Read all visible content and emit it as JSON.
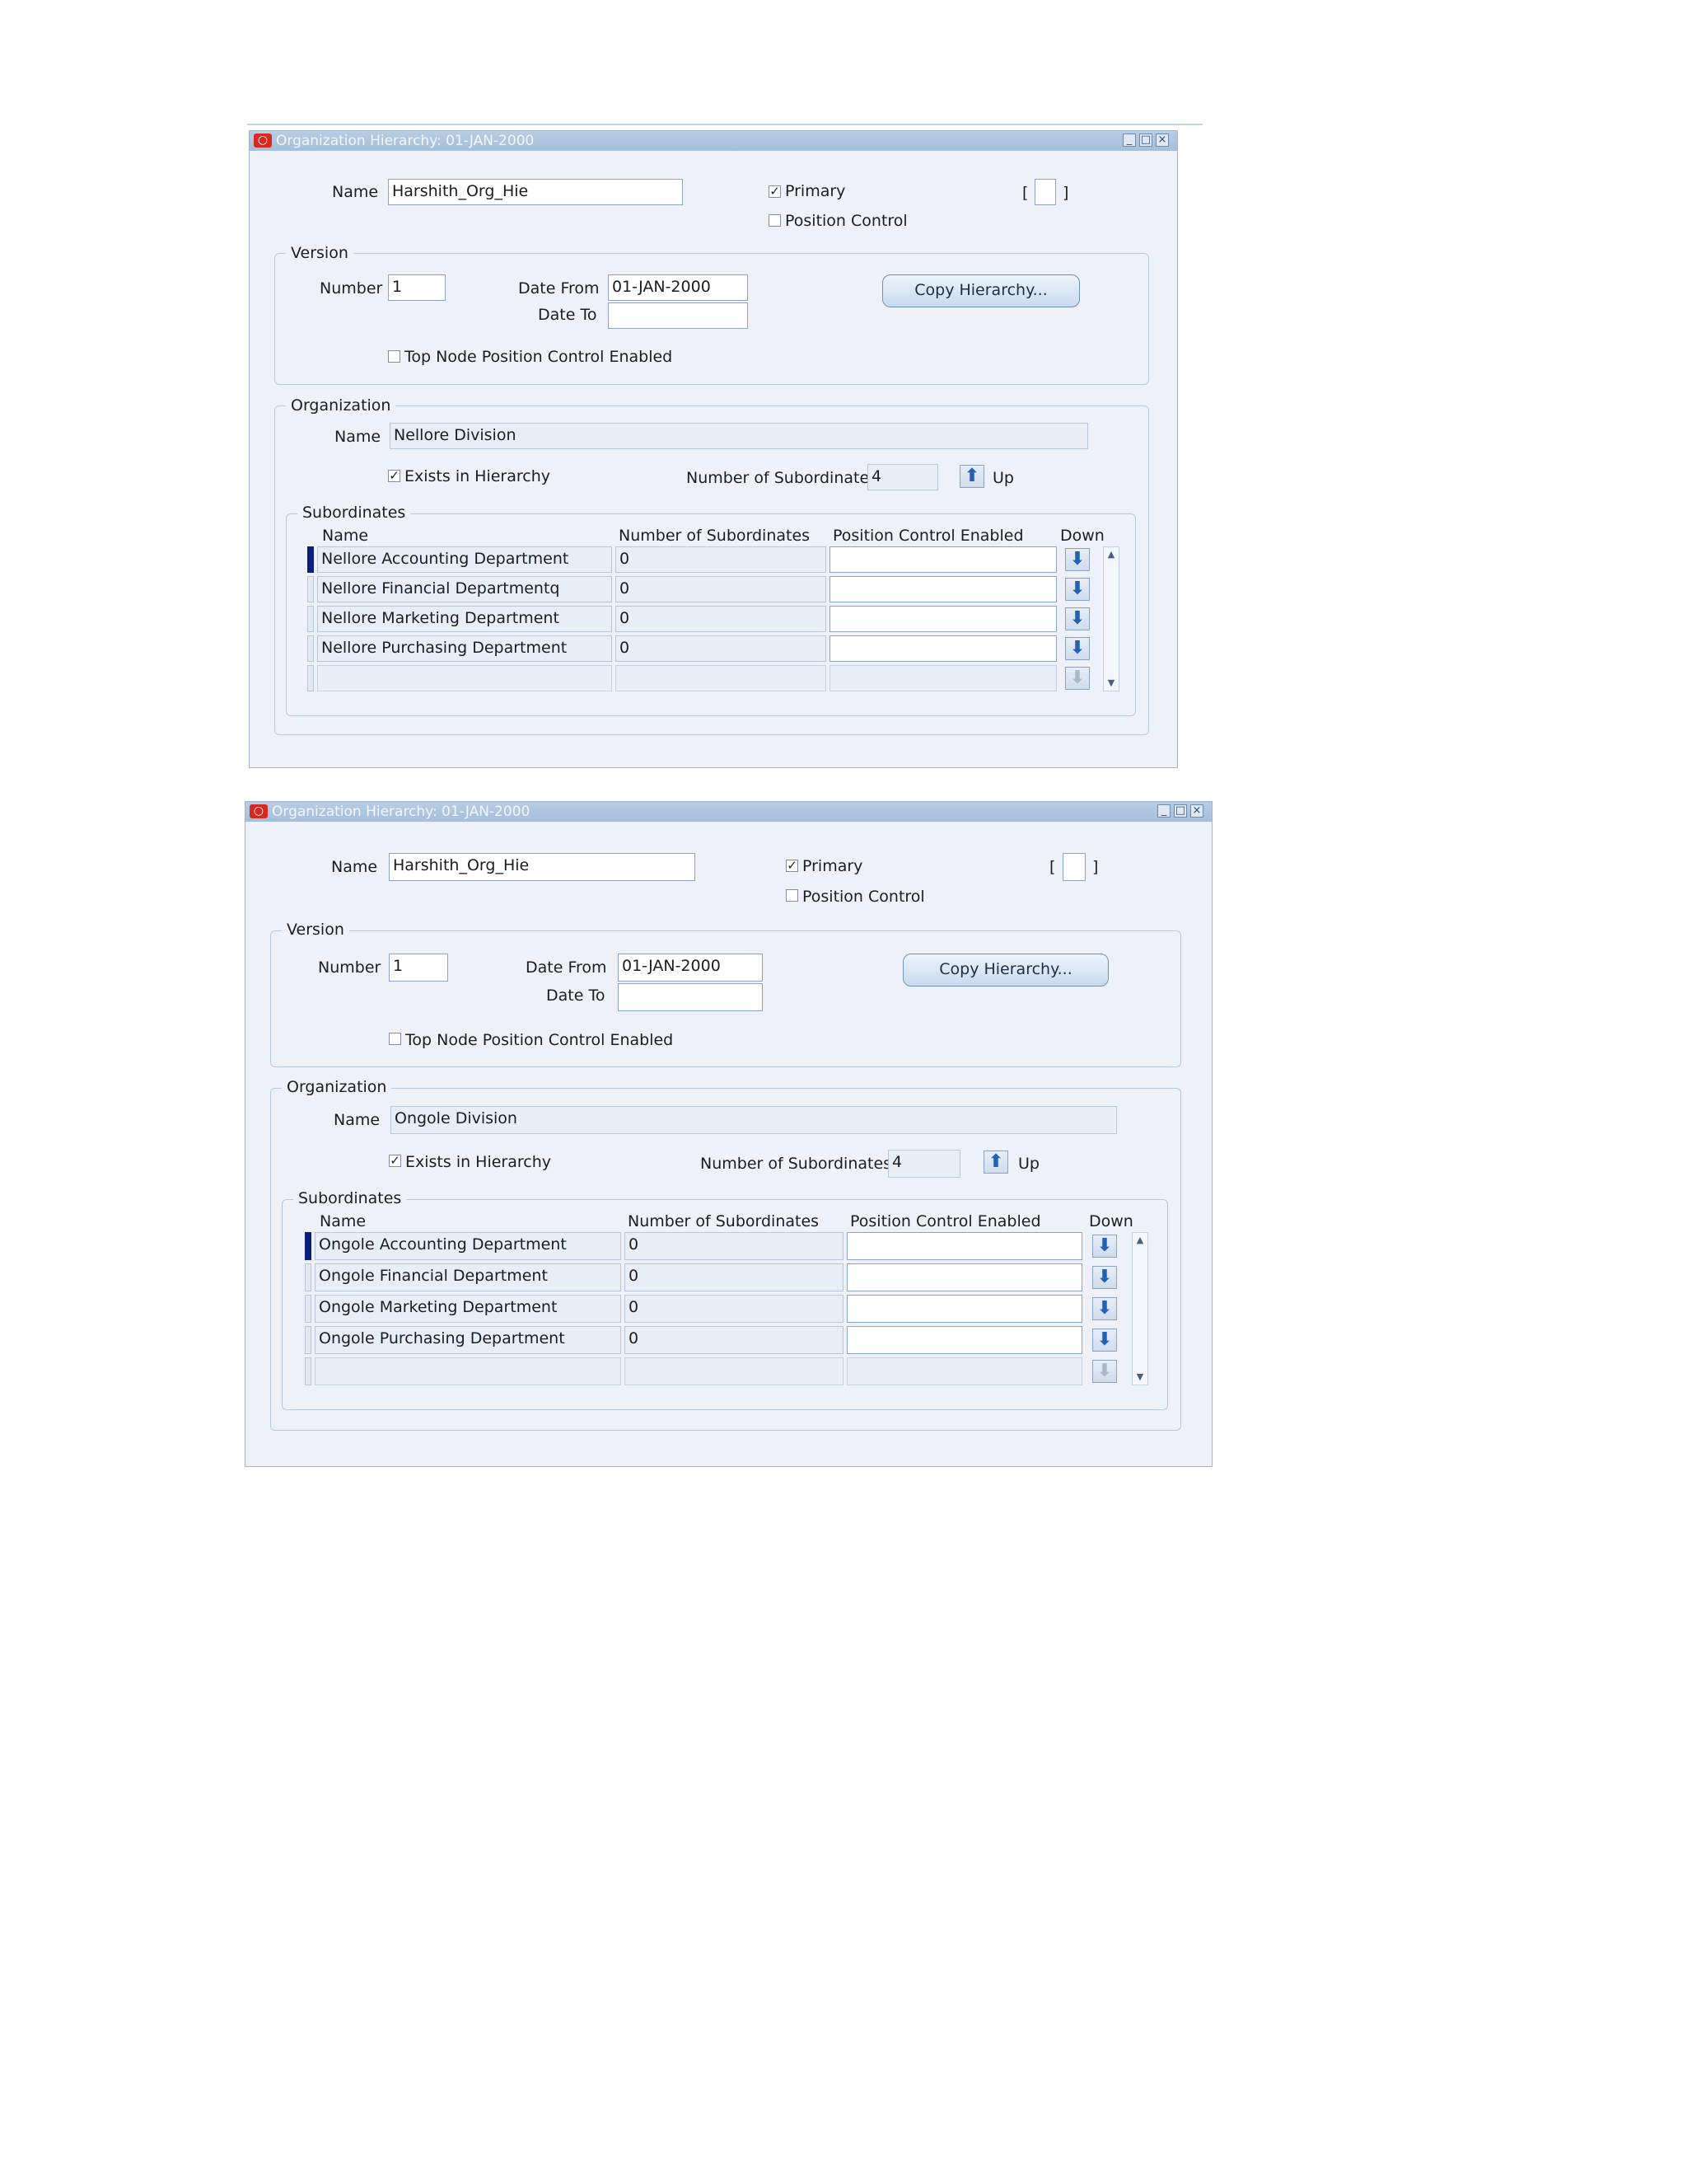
{
  "windows": [
    {
      "title": "Organization Hierarchy: 01-JAN-2000",
      "name_label": "Name",
      "name_value": "Harshith_Org_Hie",
      "primary_label": "Primary",
      "primary_checked": true,
      "position_control_label": "Position Control",
      "position_control_checked": false,
      "bracket_left": "[",
      "bracket_right": "]",
      "version": {
        "group_label": "Version",
        "number_label": "Number",
        "number_value": "1",
        "date_from_label": "Date From",
        "date_from_value": "01-JAN-2000",
        "date_to_label": "Date To",
        "date_to_value": "",
        "copy_button": "Copy Hierarchy...",
        "top_node_label": "Top Node Position Control Enabled",
        "top_node_checked": false
      },
      "organization": {
        "group_label": "Organization",
        "name_label": "Name",
        "name_value": "Nellore Division",
        "exists_label": "Exists in Hierarchy",
        "exists_checked": true,
        "num_sub_label": "Number of Subordinates",
        "num_sub_value": "4",
        "up_label": "Up"
      },
      "subordinates": {
        "group_label": "Subordinates",
        "headers": [
          "Name",
          "Number of Subordinates",
          "Position Control Enabled",
          "Down"
        ],
        "rows": [
          {
            "name": "Nellore Accounting Department",
            "count": "0",
            "pce": ""
          },
          {
            "name": "Nellore Financial Departmentq",
            "count": "0",
            "pce": ""
          },
          {
            "name": "Nellore Marketing Department",
            "count": "0",
            "pce": ""
          },
          {
            "name": "Nellore Purchasing Department",
            "count": "0",
            "pce": ""
          },
          {
            "name": "",
            "count": "",
            "pce": ""
          }
        ]
      }
    },
    {
      "title": "Organization Hierarchy: 01-JAN-2000",
      "name_label": "Name",
      "name_value": "Harshith_Org_Hie",
      "primary_label": "Primary",
      "primary_checked": true,
      "position_control_label": "Position Control",
      "position_control_checked": false,
      "bracket_left": "[",
      "bracket_right": "]",
      "version": {
        "group_label": "Version",
        "number_label": "Number",
        "number_value": "1",
        "date_from_label": "Date From",
        "date_from_value": "01-JAN-2000",
        "date_to_label": "Date To",
        "date_to_value": "",
        "copy_button": "Copy Hierarchy...",
        "top_node_label": "Top Node Position Control Enabled",
        "top_node_checked": false
      },
      "organization": {
        "group_label": "Organization",
        "name_label": "Name",
        "name_value": "Ongole Division",
        "exists_label": "Exists in Hierarchy",
        "exists_checked": true,
        "num_sub_label": "Number of Subordinates",
        "num_sub_value": "4",
        "up_label": "Up"
      },
      "subordinates": {
        "group_label": "Subordinates",
        "headers": [
          "Name",
          "Number of Subordinates",
          "Position Control Enabled",
          "Down"
        ],
        "rows": [
          {
            "name": "Ongole Accounting Department",
            "count": "0",
            "pce": ""
          },
          {
            "name": "Ongole Financial Department",
            "count": "0",
            "pce": ""
          },
          {
            "name": "Ongole Marketing Department",
            "count": "0",
            "pce": ""
          },
          {
            "name": "Ongole Purchasing Department",
            "count": "0",
            "pce": ""
          },
          {
            "name": "",
            "count": "",
            "pce": ""
          }
        ]
      }
    }
  ],
  "icons": {
    "logo": "oracle-logo-icon",
    "minimize": "minimize-icon",
    "maximize": "maximize-icon",
    "close": "close-icon",
    "up_arrow": "arrow-up-icon",
    "down_arrow": "arrow-down-icon"
  },
  "colors": {
    "titlebar": "#a4bedb",
    "window_bg": "#eef2f8",
    "current_row_marker": "#0d1d7a",
    "arrow": "#2361b5"
  }
}
